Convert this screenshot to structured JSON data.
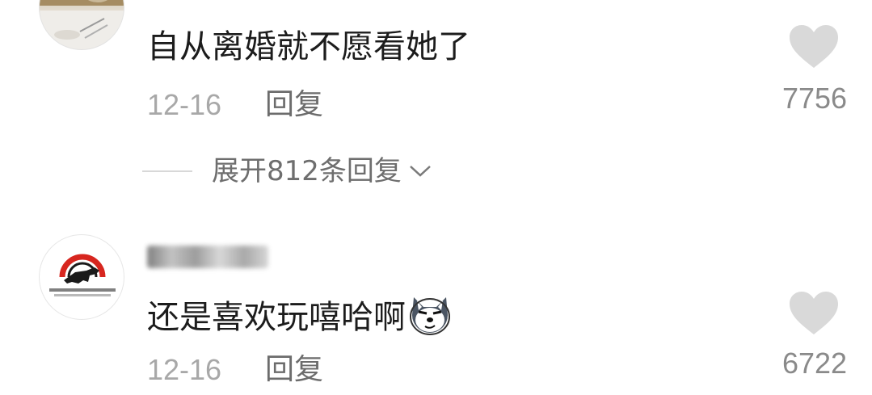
{
  "comments": [
    {
      "username": "",
      "text": "自从离婚就不愿看她了",
      "date": "12-16",
      "reply_label": "回复",
      "likes": "7756",
      "avatar_icon": "user-photo-avatar",
      "expand_replies_label": "展开812条回复"
    },
    {
      "username": "",
      "text": "还是喜欢玩嘻哈啊",
      "emoji_icon": "wolf-smirk-emoji",
      "date": "12-16",
      "reply_label": "回复",
      "likes": "6722",
      "avatar_icon": "company-horse-logo-avatar"
    }
  ],
  "colors": {
    "text": "#1c1c1c",
    "meta": "#a8a8a8",
    "reply": "#6c6c6c",
    "like_icon": "#d9d9d9",
    "like_count": "#8a8a8a",
    "logo_red": "#d7261f"
  }
}
